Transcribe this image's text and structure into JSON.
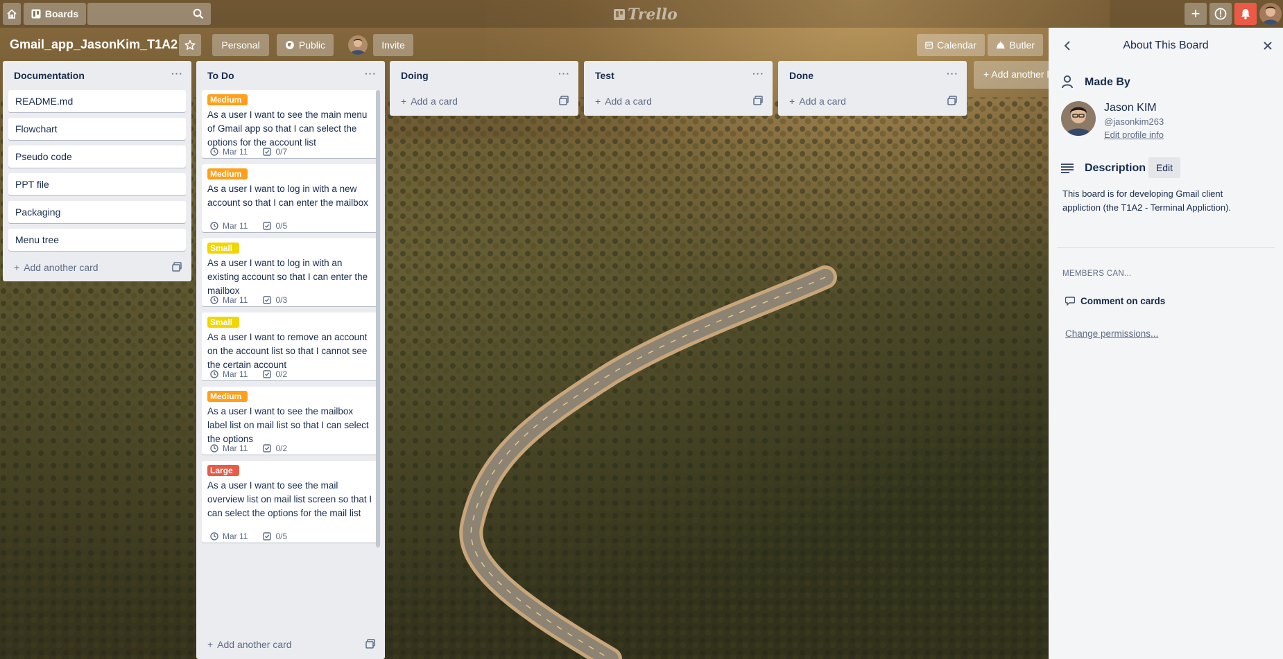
{
  "header": {
    "boards_label": "Boards",
    "search_placeholder": "",
    "logo_text": "Trello",
    "notification_color": "#eb5a46"
  },
  "board": {
    "title": "Gmail_app_JasonKim_T1A2",
    "personal_label": "Personal",
    "visibility_label": "Public",
    "invite_label": "Invite",
    "calendar_label": "Calendar",
    "butler_label": "Butler",
    "add_list_label": "Add another list"
  },
  "lists": [
    {
      "title": "Documentation",
      "cards": [
        "README.md",
        "Flowchart",
        "Pseudo code",
        "PPT file",
        "Packaging",
        "Menu tree"
      ],
      "add_label": "Add another card"
    },
    {
      "title": "To Do",
      "cards": [
        {
          "label": "Medium",
          "label_color": "#ff9f1a",
          "text": "As a user I want to see the main menu of Gmail app so that I can select the options for the account list",
          "due": "Mar 11",
          "checklist": "0/7"
        },
        {
          "label": "Medium",
          "label_color": "#ff9f1a",
          "text": "As a user I want to log in with a new account so that I can enter the mailbox",
          "due": "Mar 11",
          "checklist": "0/5"
        },
        {
          "label": "Small",
          "label_color": "#f2d600",
          "text": "As a user I want to log in with an existing account so that I can enter the mailbox",
          "due": "Mar 11",
          "checklist": "0/3"
        },
        {
          "label": "Small",
          "label_color": "#f2d600",
          "text": "As a user I want to remove an account on the account list so that I cannot see the certain account",
          "due": "Mar 11",
          "checklist": "0/2"
        },
        {
          "label": "Medium",
          "label_color": "#ff9f1a",
          "text": "As a user I want to see the mailbox label list on mail list so that I can select the options",
          "due": "Mar 11",
          "checklist": "0/2"
        },
        {
          "label": "Large",
          "label_color": "#eb5a46",
          "text": "As a user I want to see the mail overview list on mail list screen so that I can select the options for the mail list",
          "due": "Mar 11",
          "checklist": "0/5"
        }
      ],
      "add_label": "Add another card"
    },
    {
      "title": "Doing",
      "add_label": "Add a card"
    },
    {
      "title": "Test",
      "add_label": "Add a card"
    },
    {
      "title": "Done",
      "add_label": "Add a card"
    }
  ],
  "panel": {
    "title": "About This Board",
    "made_by_heading": "Made By",
    "creator_name": "Jason KIM",
    "creator_username": "@jasonkim263",
    "edit_profile": "Edit profile info",
    "description_heading": "Description",
    "edit_label": "Edit",
    "description_line1": "This board is for developing Gmail client",
    "description_line2": "appliction (the T1A2 - Terminal Appliction).",
    "members_heading": "MEMBERS CAN...",
    "permission": "Comment on cards",
    "change_permissions": "Change permissions..."
  },
  "icons": [
    "home-icon",
    "boards-icon",
    "search-icon",
    "plus-icon",
    "info-icon",
    "bell-icon",
    "star-icon",
    "globe-icon",
    "calendar-icon",
    "butler-icon",
    "back-arrow-icon",
    "close-icon",
    "user-icon",
    "description-icon",
    "comment-icon",
    "clock-icon",
    "checklist-icon",
    "card-template-icon"
  ]
}
